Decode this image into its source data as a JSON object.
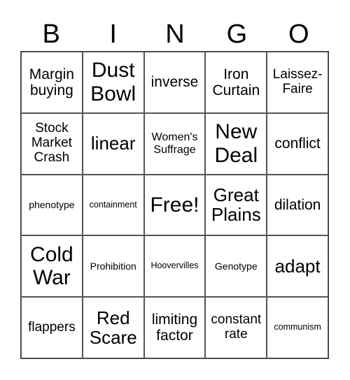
{
  "header": [
    "B",
    "I",
    "N",
    "G",
    "O"
  ],
  "cells": [
    {
      "text": "Margin buying",
      "size": "s-m"
    },
    {
      "text": "Dust Bowl",
      "size": "s-xl"
    },
    {
      "text": "inverse",
      "size": "s-m"
    },
    {
      "text": "Iron Curtain",
      "size": "s-m"
    },
    {
      "text": "Laissez-Faire",
      "size": "s-ms"
    },
    {
      "text": "Stock Market Crash",
      "size": "s-ms"
    },
    {
      "text": "linear",
      "size": "s-l"
    },
    {
      "text": "Women's Suffrage",
      "size": "s-s"
    },
    {
      "text": "New Deal",
      "size": "s-xl"
    },
    {
      "text": "conflict",
      "size": "s-m"
    },
    {
      "text": "phenotype",
      "size": "s-xs"
    },
    {
      "text": "containment",
      "size": "s-xxs"
    },
    {
      "text": "Free!",
      "size": "s-xl"
    },
    {
      "text": "Great Plains",
      "size": "s-l"
    },
    {
      "text": "dilation",
      "size": "s-m"
    },
    {
      "text": "Cold War",
      "size": "s-xl"
    },
    {
      "text": "Prohibition",
      "size": "s-xs"
    },
    {
      "text": "Hoovervilles",
      "size": "s-xxs"
    },
    {
      "text": "Genotype",
      "size": "s-xs"
    },
    {
      "text": "adapt",
      "size": "s-l"
    },
    {
      "text": "flappers",
      "size": "s-ms"
    },
    {
      "text": "Red Scare",
      "size": "s-l"
    },
    {
      "text": "limiting factor",
      "size": "s-m"
    },
    {
      "text": "constant rate",
      "size": "s-ms"
    },
    {
      "text": "communism",
      "size": "s-xxs"
    }
  ]
}
